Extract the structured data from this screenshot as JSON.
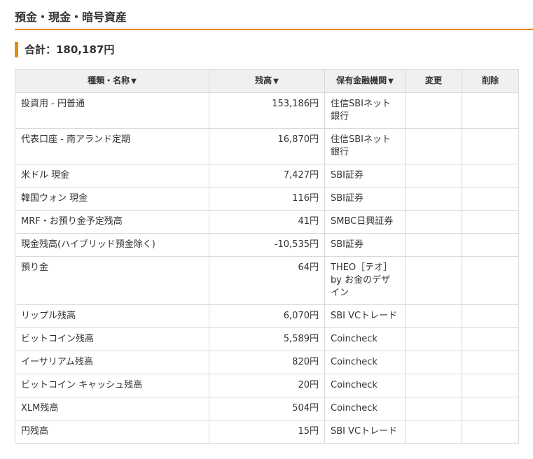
{
  "section": {
    "title": "預金・現金・暗号資産"
  },
  "total": {
    "label": "合計：180,187円"
  },
  "table": {
    "headers": {
      "name": "種類・名称",
      "balance": "残高",
      "institution": "保有金融機関",
      "edit": "変更",
      "delete": "削除"
    },
    "sort_arrow": "▼",
    "rows": [
      {
        "name": "投資用 - 円普通",
        "balance": "153,186円",
        "institution": "住信SBIネット銀行"
      },
      {
        "name": "代表口座 - 南アランド定期",
        "balance": "16,870円",
        "institution": "住信SBIネット銀行"
      },
      {
        "name": "米ドル 現金",
        "balance": "7,427円",
        "institution": "SBI証券"
      },
      {
        "name": "韓国ウォン 現金",
        "balance": "116円",
        "institution": "SBI証券"
      },
      {
        "name": "MRF・お預り金予定残高",
        "balance": "41円",
        "institution": "SMBC日興証券"
      },
      {
        "name": "現金残高(ハイブリッド預金除く)",
        "balance": "-10,535円",
        "institution": "SBI証券"
      },
      {
        "name": "預り金",
        "balance": "64円",
        "institution": "THEO［テオ］by お金のデザイン"
      },
      {
        "name": "リップル残高",
        "balance": "6,070円",
        "institution": "SBI VCトレード"
      },
      {
        "name": "ビットコイン残高",
        "balance": "5,589円",
        "institution": "Coincheck"
      },
      {
        "name": "イーサリアム残高",
        "balance": "820円",
        "institution": "Coincheck"
      },
      {
        "name": "ビットコイン キャッシュ残高",
        "balance": "20円",
        "institution": "Coincheck"
      },
      {
        "name": "XLM残高",
        "balance": "504円",
        "institution": "Coincheck"
      },
      {
        "name": "円残高",
        "balance": "15円",
        "institution": "SBI VCトレード"
      }
    ]
  }
}
